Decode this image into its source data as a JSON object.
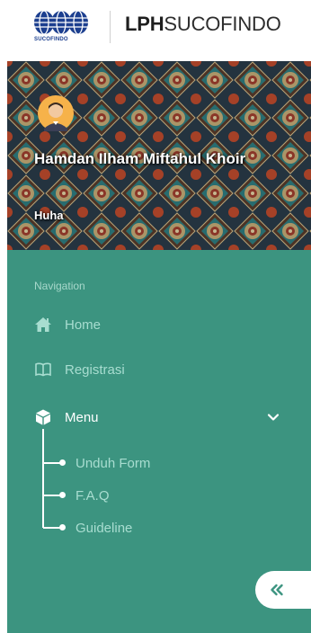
{
  "header": {
    "logo_caption": "SUCOFINDO",
    "brand_bold": "LPH",
    "brand_rest": "SUCOFINDO"
  },
  "profile": {
    "name": "Hamdan Ilham Miftahul Khoir",
    "subtitle": "Huha"
  },
  "navigation": {
    "heading": "Navigation",
    "items": [
      {
        "label": "Home",
        "icon": "home-icon"
      },
      {
        "label": "Registrasi",
        "icon": "book-icon"
      },
      {
        "label": "Menu",
        "icon": "cube-icon",
        "expanded": true
      }
    ],
    "submenu": [
      {
        "label": "Unduh Form"
      },
      {
        "label": "F.A.Q"
      },
      {
        "label": "Guideline"
      }
    ]
  },
  "colors": {
    "sidebar": "#3c9480",
    "nav_text": "#a8ddd0",
    "active_text": "#ffffff",
    "brand_blue": "#1c3f8f",
    "collapse_arrow": "#3c9480"
  },
  "collapse_button": {
    "icon": "double-chevron-left-icon"
  }
}
